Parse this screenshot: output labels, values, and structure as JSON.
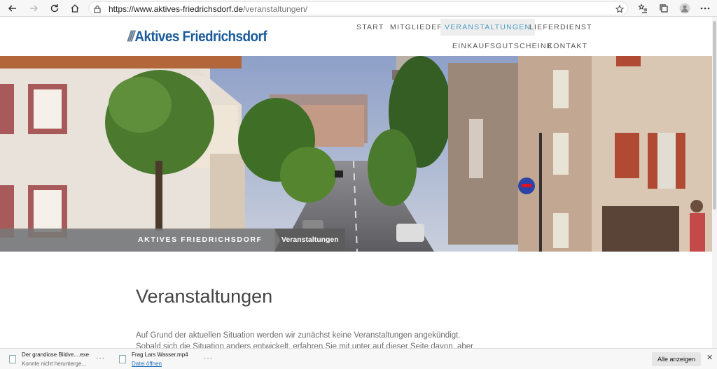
{
  "browser": {
    "url_host": "https://www.aktives-friedrichsdorf.de",
    "url_path": "/veranstaltungen/"
  },
  "site": {
    "logo_slashes": "///",
    "logo_text": "Aktives Friedrichsdorf",
    "nav": [
      "START",
      "MITGLIEDER",
      "VERANSTALTUNGEN",
      "LIEFERDIENST",
      "EINKAUFSGUTSCHEINE",
      "KONTAKT"
    ],
    "active_nav": "VERANSTALTUNGEN",
    "breadcrumb": {
      "home": "AKTIVES FRIEDRICHSDORF",
      "current": "Veranstaltungen"
    },
    "page_title": "Veranstaltungen",
    "body_lines": [
      "Auf Grund der aktuellen Situation werden wir zunächst keine Veranstaltungen angekündigt.",
      "Sobald sich die Situation anders entwickelt, erfahren Sie mit unter auf dieser Seite davon, aber"
    ]
  },
  "downloads": {
    "items": [
      {
        "name": "Der grandiose Bildve....exe",
        "status": "Konnte nicht herunterge..."
      },
      {
        "name": "Frag Lars Wasser.mp4",
        "status": "Datei öffnen"
      }
    ],
    "show_all": "Alle anzeigen"
  },
  "colors": {
    "brand": "#1d5c9c",
    "nav_active": "#4d9ec6",
    "breadcrumb_bg": "#787878"
  }
}
